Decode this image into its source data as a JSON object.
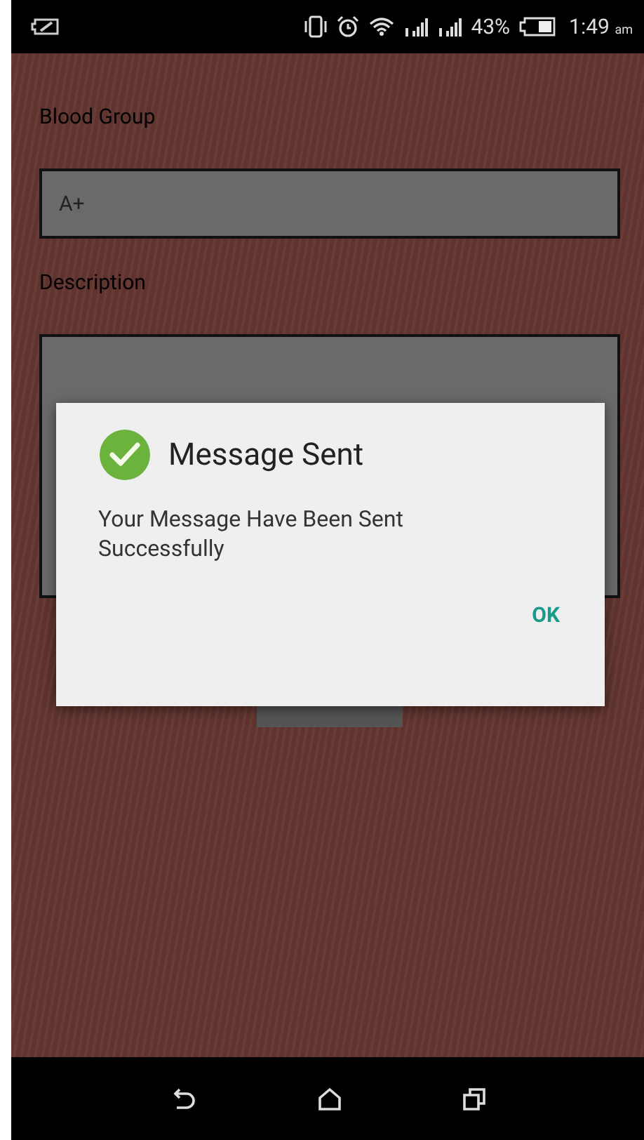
{
  "status_bar": {
    "battery_percent": "43%",
    "time": "1:49",
    "meridiem": "am"
  },
  "form": {
    "fields": [
      {
        "label": "Blood Group",
        "value": "A+",
        "kind": "line"
      },
      {
        "label": "Description",
        "kind": "multiline"
      }
    ]
  },
  "dialog": {
    "title": "Message Sent",
    "message": "Your Message Have Been Sent Successfully",
    "buttons": [
      "OK"
    ]
  }
}
